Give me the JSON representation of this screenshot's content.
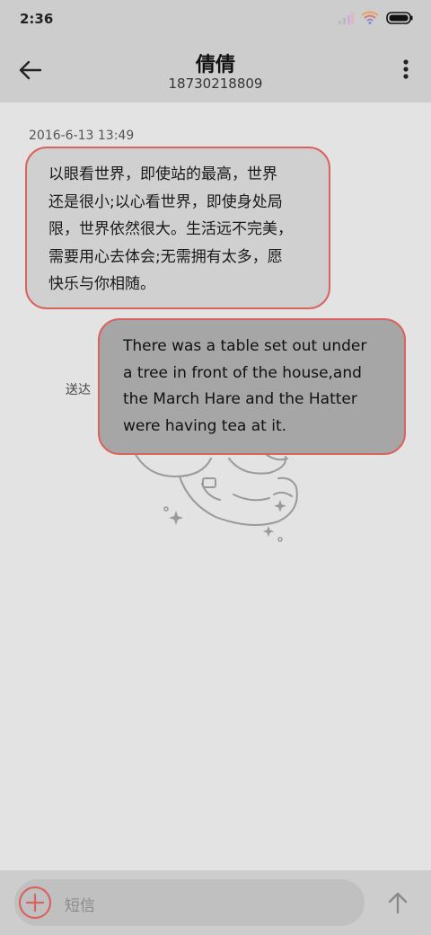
{
  "status_bar": {
    "time": "2:36"
  },
  "header": {
    "contact_name": "倩倩",
    "phone_number": "18730218809"
  },
  "conversation": {
    "timestamp": "2016-6-13 13:49",
    "incoming_message": {
      "lines": [
        "以眼看世界，即使站的最高，世界",
        "还是很小;以心看世界，即使身处局",
        "限，世界依然很大。生活远不完美，",
        "需要用心去体会;无需拥有太多，愿",
        "快乐与你相随。"
      ]
    },
    "outgoing_message": {
      "lines": [
        "There was a table set out under",
        "a tree in front of the house,and",
        "the March Hare and the Hatter",
        "were having tea at it."
      ],
      "status": "送达"
    }
  },
  "composer": {
    "placeholder": "短信"
  },
  "colors": {
    "accent": "#d9635e",
    "bar_background": "#cdcdcd",
    "page_background": "#e3e3e3",
    "incoming_bubble": "#d0d0d0",
    "outgoing_bubble": "#a6a6a6"
  },
  "icons": {
    "back": "back-arrow-icon",
    "more": "more-vert-icon",
    "add": "add-circle-icon",
    "send": "send-arrow-icon",
    "wifi": "wifi-icon",
    "signal": "signal-icon",
    "battery": "battery-icon"
  }
}
